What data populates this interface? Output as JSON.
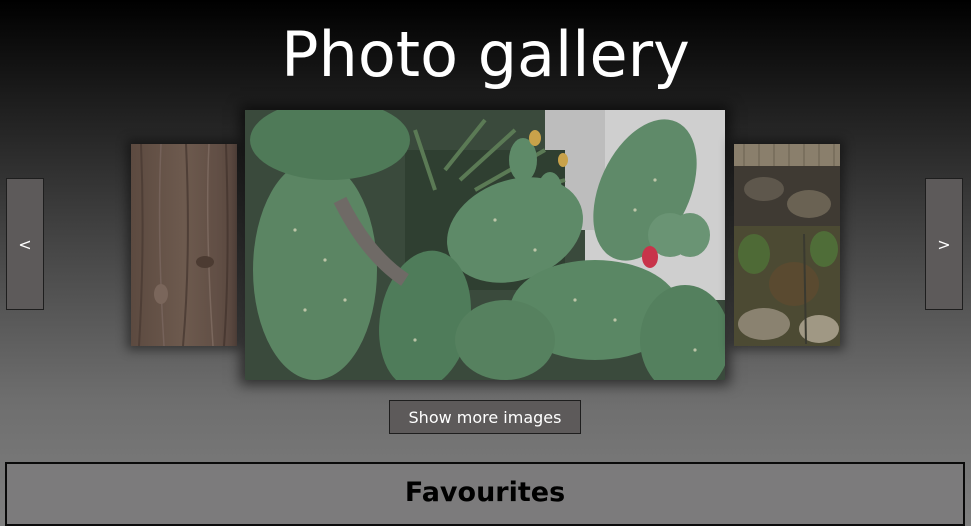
{
  "page": {
    "title": "Photo gallery"
  },
  "gallery": {
    "prev_label": "<",
    "next_label": ">",
    "images": [
      {
        "position": "left",
        "subject": "wooden plank"
      },
      {
        "position": "center",
        "subject": "prickly pear cactus"
      },
      {
        "position": "right",
        "subject": "stone wall with plants"
      }
    ],
    "more_label": "Show more images"
  },
  "favourites": {
    "heading": "Favourites"
  },
  "colors": {
    "button_bg": "#5d5a5a",
    "panel_bg": "#7c7b7c",
    "title_text": "#ffffff"
  }
}
